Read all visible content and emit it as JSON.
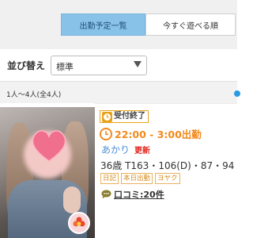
{
  "tabs": [
    {
      "label": "出勤予定一覧",
      "active": true
    },
    {
      "label": "今すぐ遊べる順",
      "active": false
    }
  ],
  "sort": {
    "label": "並び替え",
    "selected": "標準"
  },
  "count": {
    "text": "1人〜4人(全4人)"
  },
  "card": {
    "status": "受付終了",
    "time": "22:00 - 3:00出勤",
    "name": "あかり",
    "updated": "更新",
    "stats": "36歳 T163・106(D)・87・94",
    "tags": [
      "日記",
      "本日出勤",
      "ヨヤク"
    ],
    "review": "口コミ:20件"
  },
  "colors": {
    "tab_active_bg": "#88c2e8",
    "time_orange": "#f28a1d",
    "name_blue": "#4f8ed6",
    "updated_red": "#e3261e",
    "tag_orange": "#e9b25c"
  }
}
